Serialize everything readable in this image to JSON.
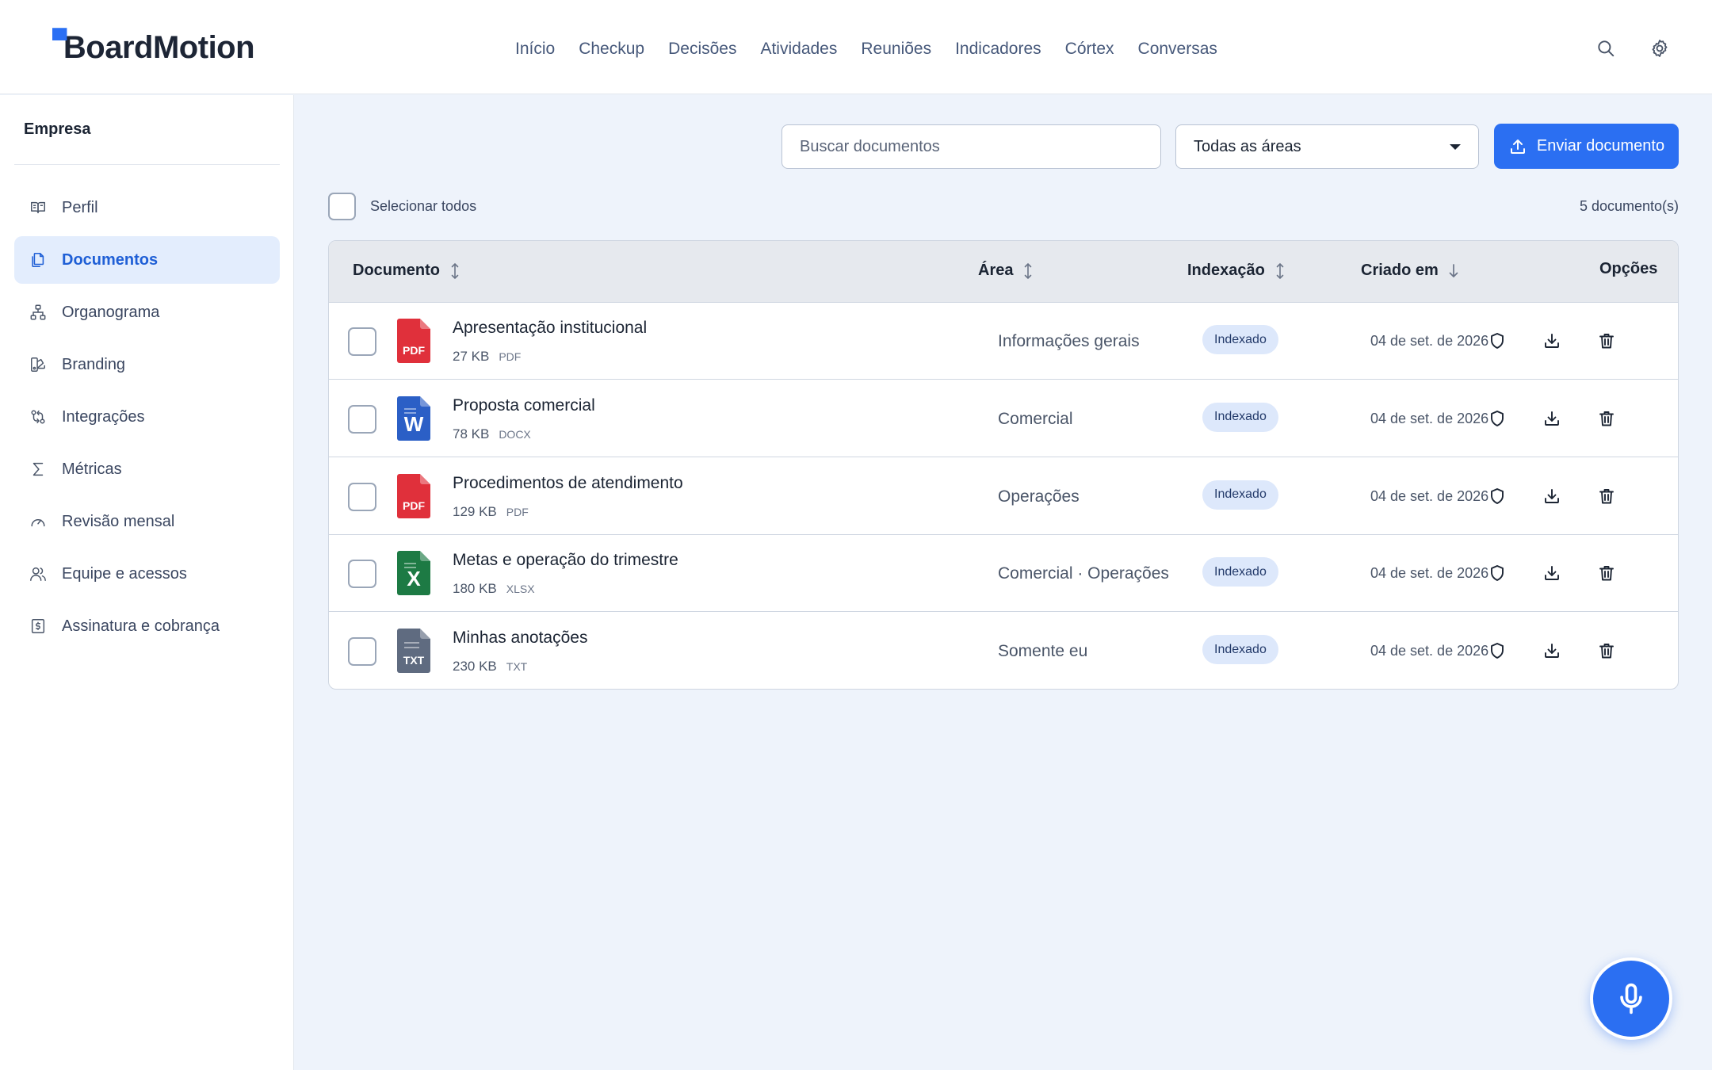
{
  "brand": {
    "name": "BoardMotion"
  },
  "nav": {
    "items": [
      "Início",
      "Checkup",
      "Decisões",
      "Atividades",
      "Reuniões",
      "Indicadores",
      "Córtex",
      "Conversas"
    ]
  },
  "header": {
    "search_icon": "search-icon",
    "settings_icon": "gear-icon"
  },
  "sidebar": {
    "heading": "Empresa",
    "items": [
      {
        "label": "Perfil",
        "icon": "book-open-icon",
        "active": false
      },
      {
        "label": "Documentos",
        "icon": "documents-icon",
        "active": true
      },
      {
        "label": "Organograma",
        "icon": "org-chart-icon",
        "active": false
      },
      {
        "label": "Branding",
        "icon": "palette-icon",
        "active": false
      },
      {
        "label": "Integrações",
        "icon": "integrations-icon",
        "active": false
      },
      {
        "label": "Métricas",
        "icon": "sigma-icon",
        "active": false
      },
      {
        "label": "Revisão mensal",
        "icon": "gauge-icon",
        "active": false
      },
      {
        "label": "Equipe e acessos",
        "icon": "users-icon",
        "active": false
      },
      {
        "label": "Assinatura e cobrança",
        "icon": "billing-icon",
        "active": false
      }
    ]
  },
  "toolbar": {
    "search_placeholder": "Buscar documentos",
    "area_filter": "Todas as áreas",
    "upload_label": "Enviar documento",
    "select_all_label": "Selecionar todos",
    "doc_count": "5 documento(s)"
  },
  "table": {
    "headers": {
      "document": "Documento",
      "area": "Área",
      "indexing": "Indexação",
      "created": "Criado em",
      "options": "Opções"
    },
    "rows": [
      {
        "name": "Apresentação institucional",
        "size": "27 KB",
        "ext": "PDF",
        "type": "pdf",
        "area": "Informações gerais",
        "status": "Indexado",
        "created": "04 de set. de 2026"
      },
      {
        "name": "Proposta comercial",
        "size": "78 KB",
        "ext": "DOCX",
        "type": "docx",
        "area": "Comercial",
        "status": "Indexado",
        "created": "04 de set. de 2026"
      },
      {
        "name": "Procedimentos de atendimento",
        "size": "129 KB",
        "ext": "PDF",
        "type": "pdf",
        "area": "Operações",
        "status": "Indexado",
        "created": "04 de set. de 2026"
      },
      {
        "name": "Metas e operação do trimestre",
        "size": "180 KB",
        "ext": "XLSX",
        "type": "xlsx",
        "area": "Comercial · Operações",
        "status": "Indexado",
        "created": "04 de set. de 2026"
      },
      {
        "name": "Minhas anotações",
        "size": "230 KB",
        "ext": "TXT",
        "type": "txt",
        "area": "Somente eu",
        "status": "Indexado",
        "created": "04 de set. de 2026"
      }
    ]
  },
  "file_icons": {
    "pdf": {
      "color": "#e0303b",
      "glyph": "PDF"
    },
    "docx": {
      "color": "#2b5fc6",
      "glyph": "W"
    },
    "xlsx": {
      "color": "#1d7a44",
      "glyph": "X"
    },
    "txt": {
      "color": "#5f6b80",
      "glyph": "TXT"
    }
  },
  "fab": {
    "icon": "microphone-icon"
  },
  "colors": {
    "accent": "#2b6ff2",
    "badge_bg": "#dde8fb",
    "active_bg": "#e3edfd"
  }
}
